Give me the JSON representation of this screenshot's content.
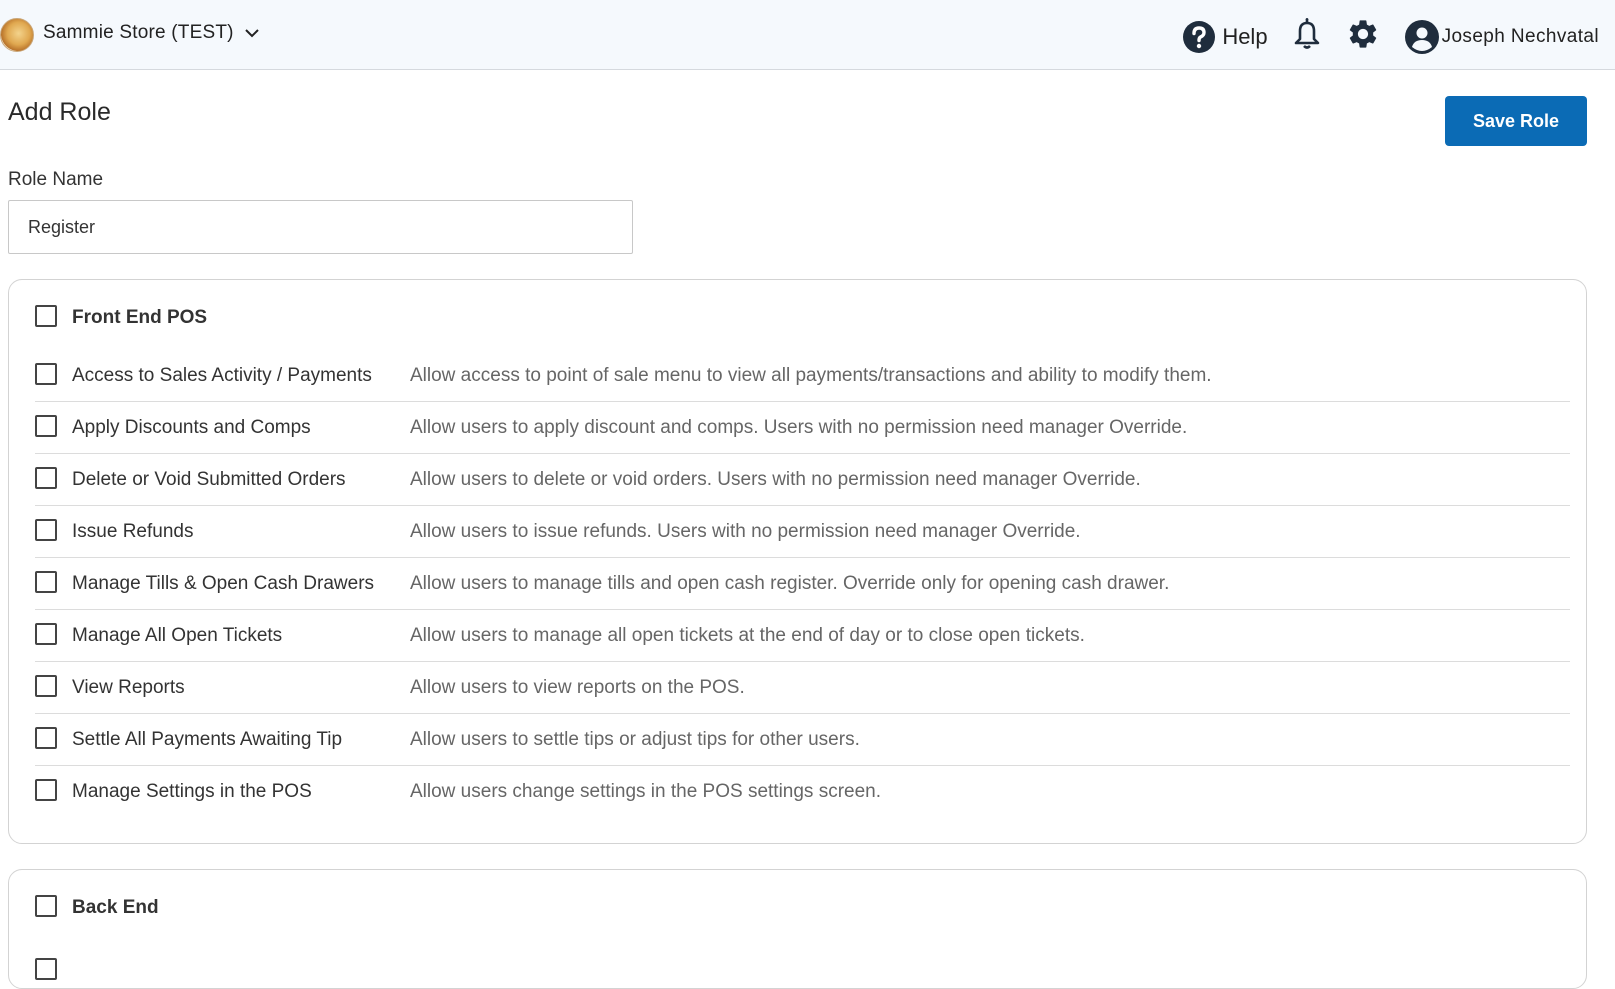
{
  "header": {
    "store_name": "Sammie Store (TEST)",
    "help_label": "Help",
    "user_name": "Joseph Nechvatal"
  },
  "page": {
    "title": "Add Role",
    "save_label": "Save Role",
    "role_name_label": "Role Name",
    "role_name_value": "Register"
  },
  "sections": [
    {
      "title": "Front End POS",
      "permissions": [
        {
          "name": "Access to Sales Activity / Payments",
          "description": "Allow access to point of sale menu to view all payments/transactions and ability to modify them."
        },
        {
          "name": "Apply Discounts and Comps",
          "description": "Allow users to apply discount and comps. Users with no permission need manager Override."
        },
        {
          "name": "Delete or Void Submitted Orders",
          "description": "Allow users to delete or void orders. Users with no permission need manager Override."
        },
        {
          "name": "Issue Refunds",
          "description": "Allow users to issue refunds. Users with no permission need manager Override."
        },
        {
          "name": "Manage Tills & Open Cash Drawers",
          "description": "Allow users to manage tills and open cash register. Override only for opening cash drawer."
        },
        {
          "name": "Manage All Open Tickets",
          "description": "Allow users to manage all open tickets at the end of day or to close open tickets."
        },
        {
          "name": "View Reports",
          "description": "Allow users to view reports on the POS."
        },
        {
          "name": "Settle All Payments Awaiting Tip",
          "description": "Allow users to settle tips or adjust tips for other users."
        },
        {
          "name": "Manage Settings in the POS",
          "description": "Allow users change settings in the POS settings screen."
        }
      ]
    },
    {
      "title": "Back End",
      "permissions": []
    }
  ],
  "colors": {
    "primary": "#0b6bb5",
    "header_bg": "#f5f9fd",
    "icon": "#1f2d3d"
  }
}
